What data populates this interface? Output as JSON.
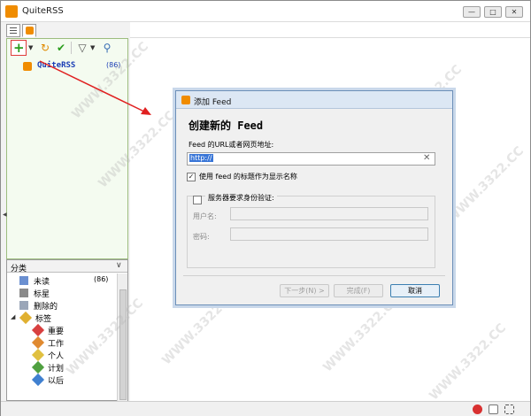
{
  "window": {
    "title": "QuiteRSS",
    "controls": [
      "—",
      "□",
      "✕"
    ]
  },
  "toolbar": {
    "icons": [
      "add-feed-icon",
      "update-icon",
      "mark-read-icon",
      "filter-icon",
      "search-icon"
    ]
  },
  "feeds": [
    {
      "name": "QuiteRSS",
      "count": "(86)"
    }
  ],
  "categories": {
    "header": "分类",
    "chevron": "∨",
    "items": [
      {
        "label": "未读",
        "count": "(86)"
      },
      {
        "label": "标星",
        "count": ""
      },
      {
        "label": "删除的",
        "count": ""
      },
      {
        "label": "标签",
        "count": ""
      },
      {
        "label": "重要",
        "count": ""
      },
      {
        "label": "工作",
        "count": ""
      },
      {
        "label": "个人",
        "count": ""
      },
      {
        "label": "计划",
        "count": ""
      },
      {
        "label": "以后",
        "count": ""
      }
    ]
  },
  "dialog": {
    "title": "添加 Feed",
    "close": "✕",
    "heading": "创建新的 Feed",
    "url_label": "Feed 的URL或者网页地址:",
    "url_value": "http://",
    "url_clear": "✕",
    "use_title_label": "使用 feed 的标题作为显示名称",
    "use_title_checked": "✓",
    "auth_label": "服务器要求身份验证:",
    "username_label": "用户名:",
    "password_label": "密码:",
    "buttons": {
      "next": "下一步(N) >",
      "finish": "完成(F)",
      "cancel": "取消"
    }
  },
  "watermark": "WWW.3322.CC",
  "colors": {
    "accent_green": "#2a9d1c",
    "feed_blue": "#1a3db5",
    "rss_orange": "#f08c00",
    "highlight": "#e03a3a"
  }
}
